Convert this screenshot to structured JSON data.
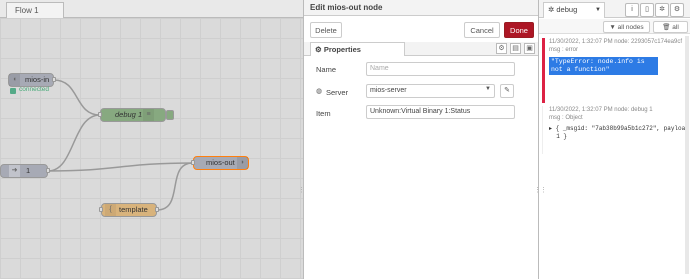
{
  "workspace": {
    "tab_label": "Flow 1",
    "nodes": {
      "mios_in": {
        "label": "mios-in",
        "status": "connected"
      },
      "debug": {
        "label": "debug 1"
      },
      "inject": {
        "label": "1"
      },
      "mios_out": {
        "label": "mios-out"
      },
      "template": {
        "label": "template"
      }
    }
  },
  "edit_panel": {
    "title": "Edit mios-out node",
    "delete_label": "Delete",
    "cancel_label": "Cancel",
    "done_label": "Done",
    "properties_tab": "Properties",
    "name_label": "Name",
    "name_placeholder": "Name",
    "server_label": "Server",
    "server_value": "mios-server",
    "item_label": "Item",
    "item_value": "Unknown:Virtual Binary 1:Status"
  },
  "debug_panel": {
    "tab_label": "debug",
    "filter_label": "all nodes",
    "clear_label": "all",
    "messages": [
      {
        "meta": "11/30/2022, 1:32:07 PM   node: 2293057c174ea9cf",
        "type": "msg : error",
        "value": "\"TypeError: node.info is not a function\""
      },
      {
        "meta": "11/30/2022, 1:32:07 PM   node: debug 1",
        "type": "msg : Object",
        "value": "▸ { _msgid: \"7ab38b99a5b1c272\", payload:\n  1 }"
      }
    ]
  },
  "colors": {
    "done": "#ad1625",
    "error_bar": "#d24",
    "selection": "#2d7be5",
    "selected_node": "#ff7f0e"
  }
}
